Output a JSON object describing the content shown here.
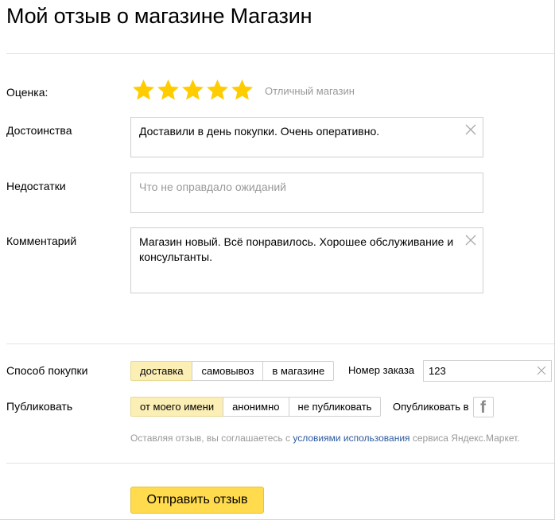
{
  "page": {
    "title": "Мой отзыв о магазине Магазин"
  },
  "rating": {
    "label": "Оценка:",
    "stars": 5,
    "max_stars": 5,
    "star_color": "#ffcc00",
    "text": "Отличный магазин"
  },
  "pros": {
    "label": "Достоинства",
    "value": "Доставили в день покупки. Очень оперативно."
  },
  "cons": {
    "label": "Недостатки",
    "placeholder": "Что не оправдало ожиданий"
  },
  "comment": {
    "label": "Комментарий",
    "value": "Магазин новый. Всё понравилось. Хорошее обслуживание и консультанты."
  },
  "purchase": {
    "label": "Способ покупки",
    "options": [
      "доставка",
      "самовывоз",
      "в магазине"
    ],
    "selected": "доставка"
  },
  "order": {
    "label": "Номер заказа",
    "value": "123"
  },
  "publish": {
    "label": "Публиковать",
    "options": [
      "от моего имени",
      "анонимно",
      "не публиковать"
    ],
    "selected": "от моего имени",
    "share_label": "Опубликовать в",
    "share_icon": "facebook-icon"
  },
  "terms": {
    "prefix": "Оставляя отзыв, вы соглашаетесь с ",
    "link": "условиями использования",
    "suffix": " сервиса Яндекс.Маркет."
  },
  "submit": {
    "label": "Отправить отзыв",
    "color": "#ffdb4d"
  }
}
